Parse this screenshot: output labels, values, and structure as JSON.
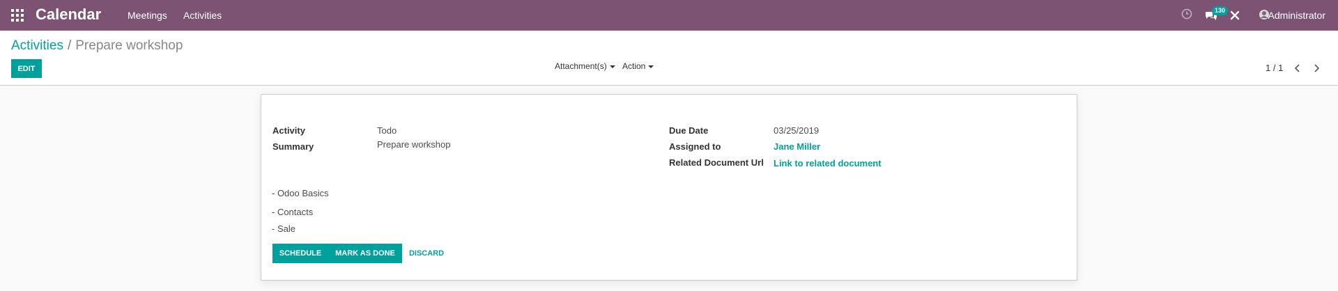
{
  "navbar": {
    "app_title": "Calendar",
    "menu": [
      "Meetings",
      "Activities"
    ],
    "messaging_badge": "130",
    "user_name": "Administrator",
    "bg_color": "#7c5373"
  },
  "breadcrumb": {
    "parent": "Activities",
    "separator": "/",
    "current": "Prepare workshop"
  },
  "control_panel": {
    "edit_label": "EDIT",
    "attachments_label": "Attachment(s)",
    "action_label": "Action",
    "pager_value": "1 / 1"
  },
  "form": {
    "left": [
      {
        "label": "Activity",
        "value": "Todo"
      },
      {
        "label": "Summary",
        "value": "Prepare workshop"
      }
    ],
    "right": [
      {
        "label": "Due Date",
        "value": "03/25/2019"
      },
      {
        "label": "Assigned to",
        "value": "Jane Miller"
      },
      {
        "label": "Related Document Url",
        "value": "Link to related document"
      }
    ],
    "note_lines": [
      "- Odoo Basics",
      "- Contacts",
      "- Sale"
    ],
    "buttons": {
      "schedule": "SCHEDULE",
      "mark_done": "MARK AS DONE",
      "discard": "DISCARD"
    }
  },
  "accent_color": "#00a09d"
}
